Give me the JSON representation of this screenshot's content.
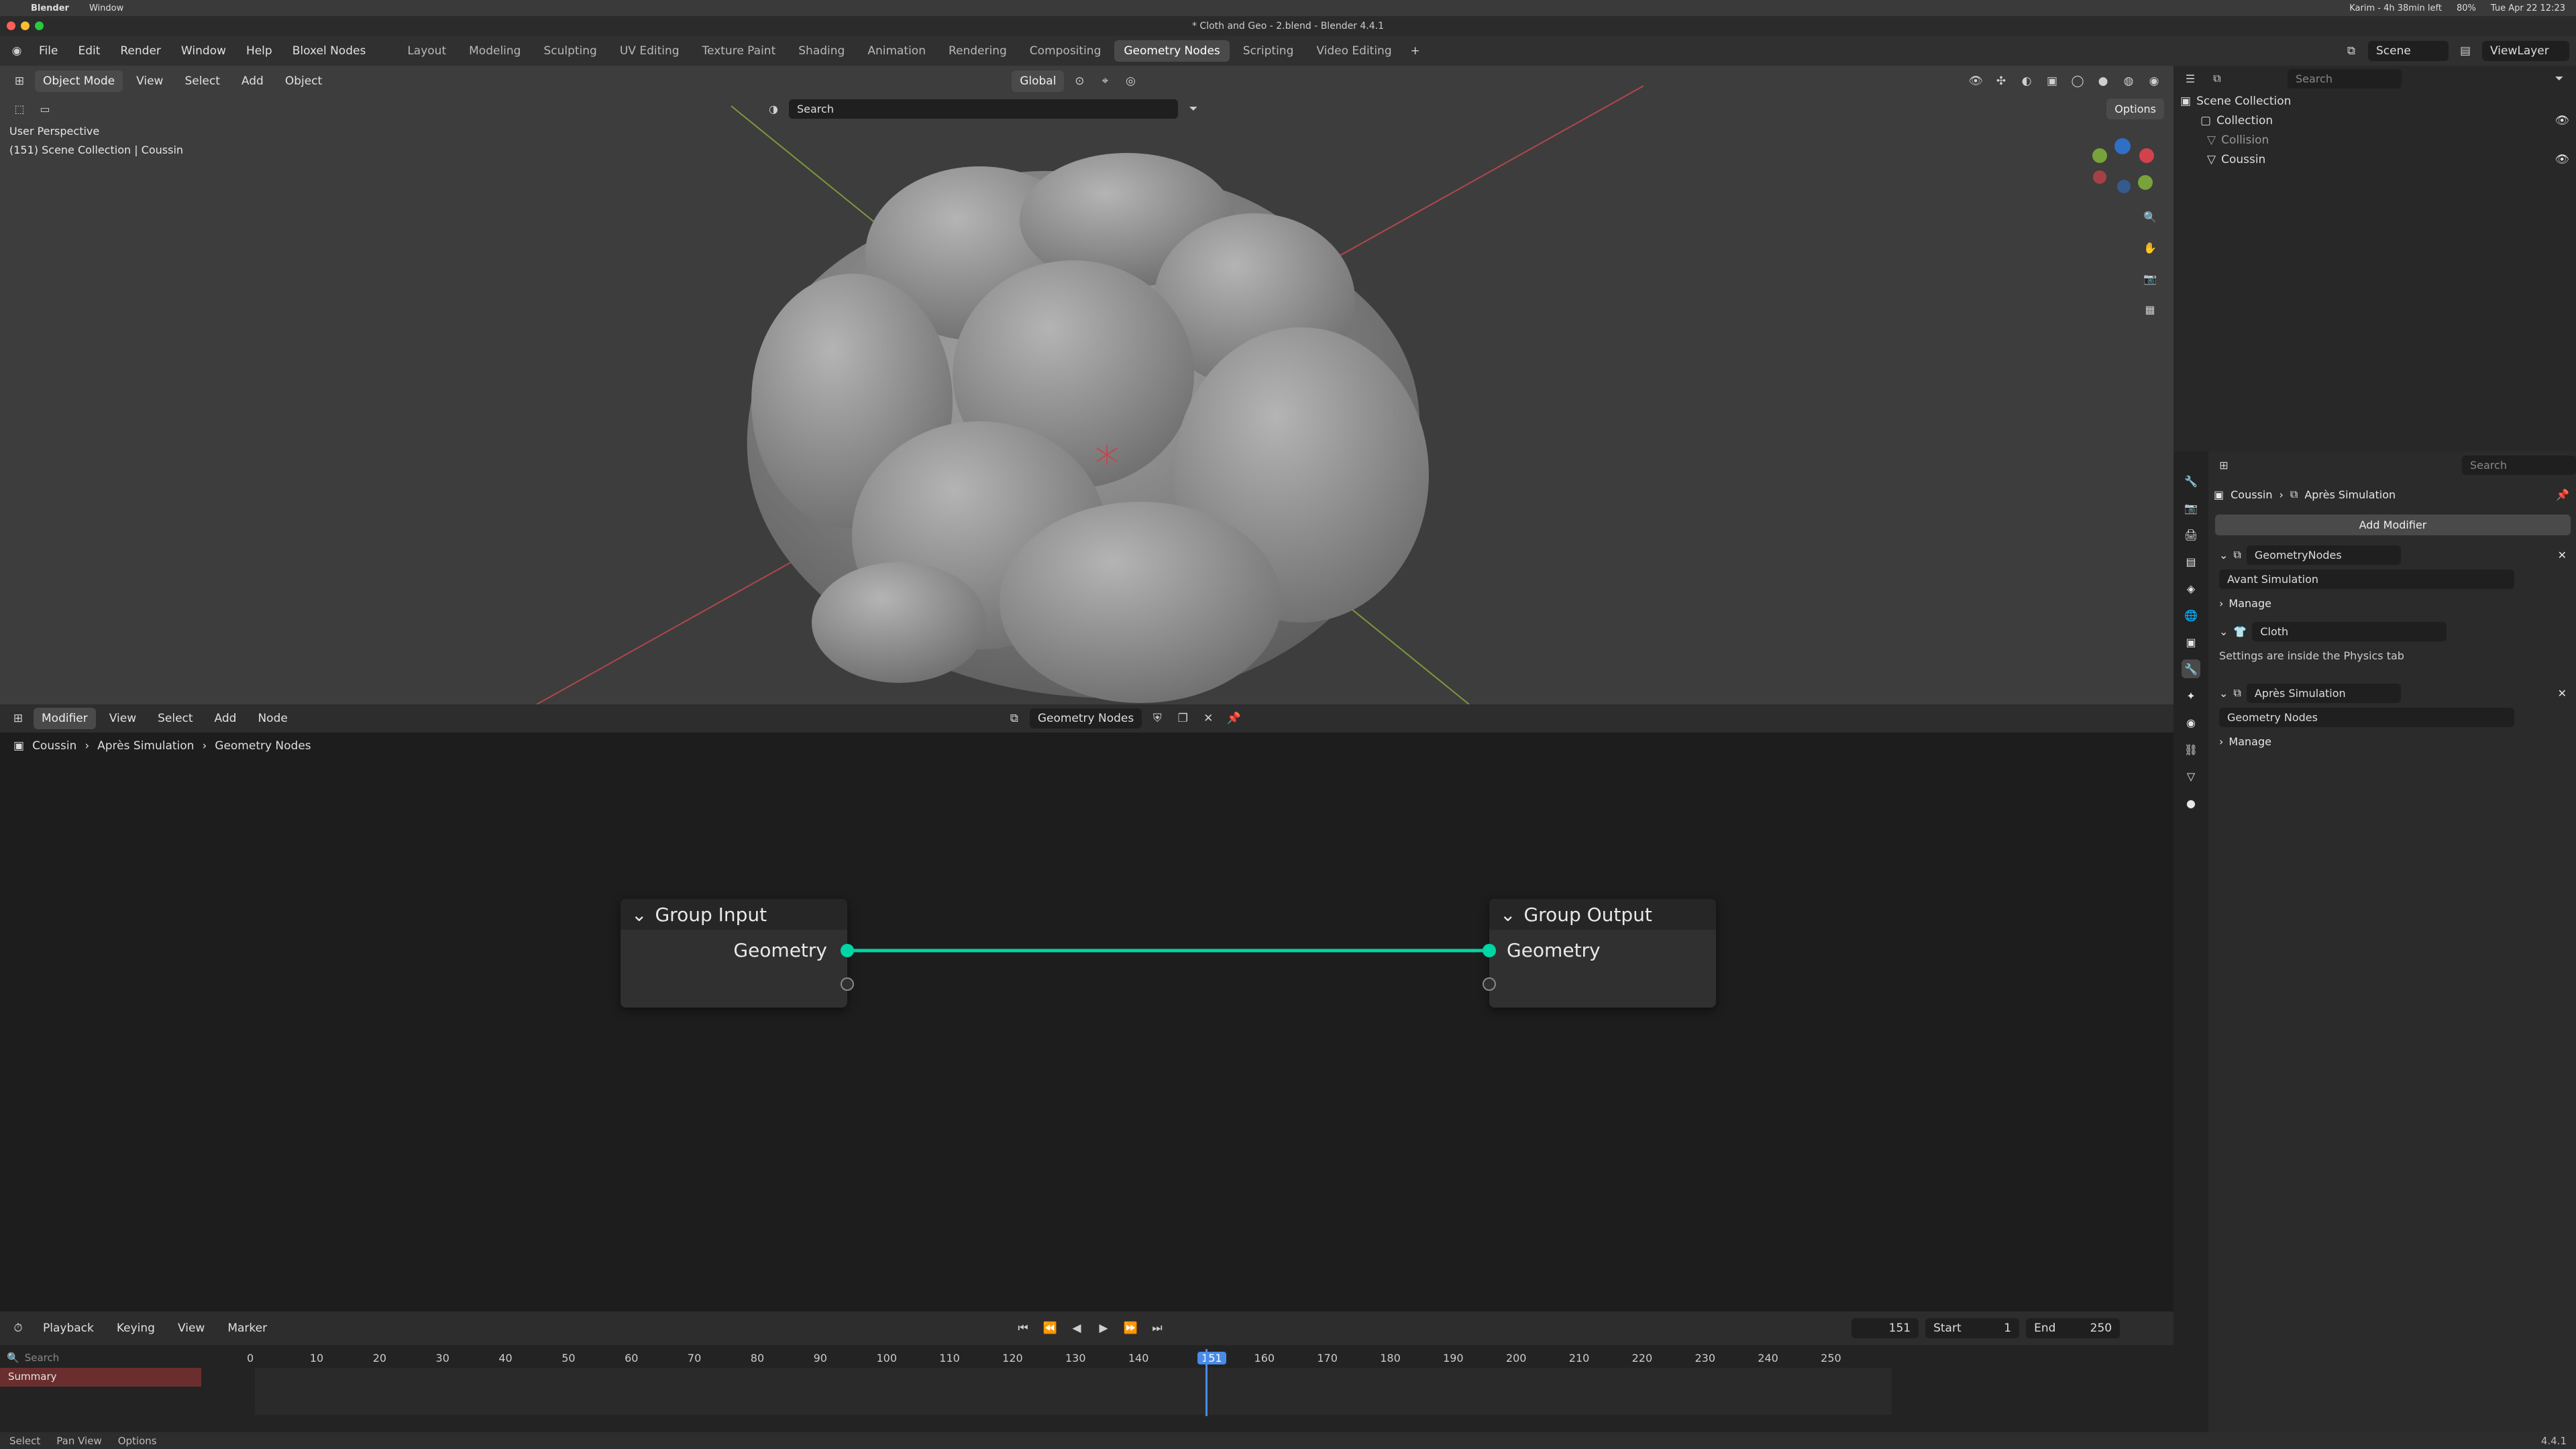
{
  "mac": {
    "apple": "",
    "app": "Blender",
    "menu_window": "Window",
    "status": "Karim - 4h 38min left",
    "battery": "80%",
    "datetime": "Tue Apr 22  12:23"
  },
  "title": "* Cloth and Geo - 2.blend - Blender 4.4.1",
  "menu": [
    "File",
    "Edit",
    "Render",
    "Window",
    "Help",
    "Bloxel Nodes"
  ],
  "workspaces": [
    "Layout",
    "Modeling",
    "Sculpting",
    "UV Editing",
    "Texture Paint",
    "Shading",
    "Animation",
    "Rendering",
    "Compositing",
    "Geometry Nodes",
    "Scripting",
    "Video Editing"
  ],
  "active_workspace": "Geometry Nodes",
  "scene": {
    "scene_label": "Scene",
    "viewlayer_label": "ViewLayer"
  },
  "viewport": {
    "mode": "Object Mode",
    "menus": [
      "View",
      "Select",
      "Add",
      "Object"
    ],
    "transform": "Global",
    "search_placeholder": "Search",
    "options": "Options",
    "perspective": "User Perspective",
    "collection_info": "(151) Scene Collection | Coussin"
  },
  "node_editor": {
    "type": "Modifier",
    "menus": [
      "View",
      "Select",
      "Add",
      "Node"
    ],
    "tree_name": "Geometry Nodes",
    "breadcrumb": [
      "Coussin",
      "Après Simulation",
      "Geometry Nodes"
    ],
    "group_input": {
      "title": "Group Input",
      "socket": "Geometry"
    },
    "group_output": {
      "title": "Group Output",
      "socket": "Geometry"
    },
    "link_color": "#00d6a3"
  },
  "timeline": {
    "menus": [
      "Playback",
      "Keying",
      "View",
      "Marker"
    ],
    "current_frame": "151",
    "start_label": "Start",
    "start": "1",
    "end_label": "End",
    "end": "250",
    "search_placeholder": "Search",
    "summary": "Summary",
    "ticks": [
      "0",
      "10",
      "20",
      "30",
      "40",
      "50",
      "60",
      "70",
      "80",
      "90",
      "100",
      "110",
      "120",
      "130",
      "140",
      "151",
      "160",
      "170",
      "180",
      "190",
      "200",
      "210",
      "220",
      "230",
      "240",
      "250"
    ]
  },
  "outliner": {
    "search_placeholder": "Search",
    "root": "Scene Collection",
    "items": [
      "Collection",
      "Collision",
      "Coussin"
    ]
  },
  "properties": {
    "search_placeholder": "Search",
    "breadcrumb": [
      "Coussin",
      "Après Simulation"
    ],
    "add_modifier": "Add Modifier",
    "modifiers": [
      {
        "name": "GeometryNodes",
        "tree": "Avant Simulation",
        "manage": "Manage"
      },
      {
        "name": "Cloth",
        "note": "Settings are inside the Physics tab"
      },
      {
        "name": "Après Simulation",
        "tree": "Geometry Nodes",
        "manage": "Manage"
      }
    ]
  },
  "status": {
    "select": "Select",
    "pan": "Pan View",
    "options": "Options",
    "version": "4.4.1"
  }
}
